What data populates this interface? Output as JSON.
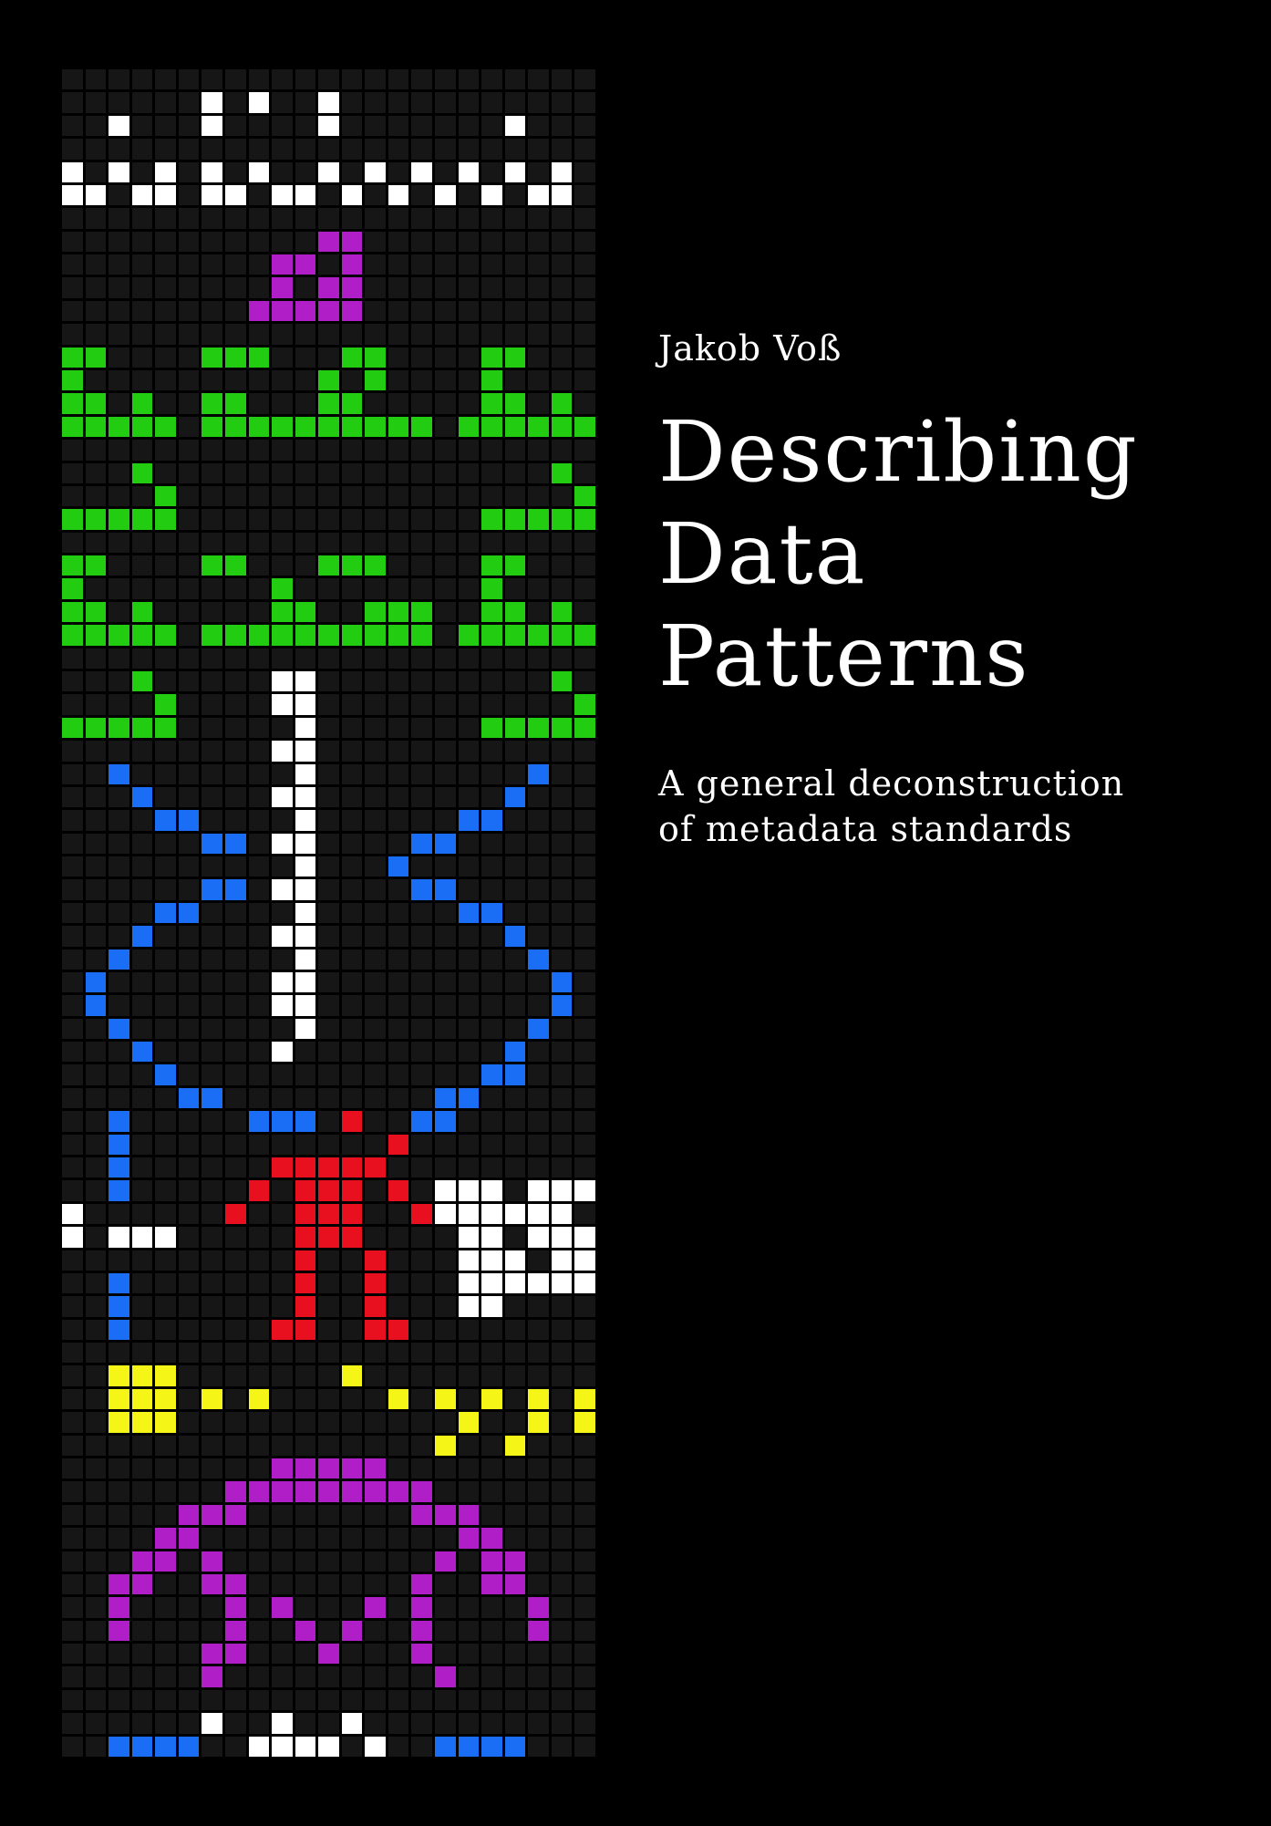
{
  "cover": {
    "author": "Jakob Voß",
    "title_lines": [
      "Describing",
      "Data Patterns"
    ],
    "subtitle_lines": [
      "A general deconstruction",
      "of metadata standards"
    ]
  },
  "artwork": {
    "name": "arecibo-style pixel message",
    "columns": 23,
    "rows": 73,
    "colors": {
      "background": "#000000",
      "empty_cell": "#161616",
      "white": "#ffffff",
      "purple": "#b01ec8",
      "green": "#22cc11",
      "blue": "#1a6ef5",
      "red": "#e8101e",
      "yellow": "#f5f518"
    },
    "rows_data": [
      ".......................",
      "......W.W..W...........",
      "..W...W....W.......W...",
      ".......................",
      "W.W.W.W.W..W.W.W.W.W.W.",
      "WW.WW.WW.WW.W.W.W.W.WW.",
      ".......................",
      "...........PP..........",
      ".........PP.P..........",
      ".........P.PP..........",
      "........PPPPP..........",
      ".......................",
      "GG....GGG...GG....GG...",
      "G..........G.G....G....",
      "GG.G..GG...GG.....GG.G.",
      "GGGGG.GGGGGGGGGG.GGGGGG",
      ".......................",
      "...G.................G.",
      "....G.................G",
      "GGGGG.............GGGGG",
      ".......................",
      "GG....GG...GGG....GG...",
      "G........G........G....",
      "GG.G.....GG..GGG..GG.G.",
      "GGGGG.GGGGGGGGGG.GGGGGG",
      ".......................",
      "...G.....WW..........G.",
      "....G....WW...........G",
      "GGGGG.....W.......GGGGG",
      ".........WW............",
      "..B.......W.........B..",
      "...B.....WW........B...",
      "....BB....W......BB....",
      "......BB.WW....BB......",
      "..........W...B........",
      "......BB.WW....BB......",
      "....BB....W......BB....",
      "...B.....WW........B...",
      "..B.......W.........B..",
      ".B.......WW..........B.",
      ".B.......WW..........B.",
      "..B.......W.........B..",
      "...B.....W.........B...",
      "....B.............BB...",
      ".....BB.........BB.....",
      "..B.....BBB.R..BB......",
      "..B...........R........",
      "..B......RRRRR.........",
      "..B.....R.RRR.R.WWW.WWW",
      "W......R..RRR..RWWWWWW.",
      "W.WWW.....RRR....WW.WWW",
      "..........R..R...WWW.WW",
      "..B.......R..R...WWWWWW",
      "..B.......R..R...WW....",
      "..B......RR..RR........",
      ".......................",
      "..YYY.......Y..........",
      "..YYY.Y.Y.....Y.Y.Y.Y.Y",
      "..YYY............Y..Y.Y",
      "................Y..Y...",
      ".........PPPPP.........",
      ".......PPPPPPPPP.......",
      ".....PPP.......PPP.....",
      "....PP...........PP....",
      "...PP.P.........P.PP...",
      "..PP..PP.......P..PP...",
      "..P....P.P...P.P....P..",
      "..P....P..P.P..P....P..",
      "......PP...P...P.......",
      "......P.........P......",
      ".......................",
      "......W..W..W..........",
      "..BBBB..WWWW.W..BBBB..."
    ]
  }
}
